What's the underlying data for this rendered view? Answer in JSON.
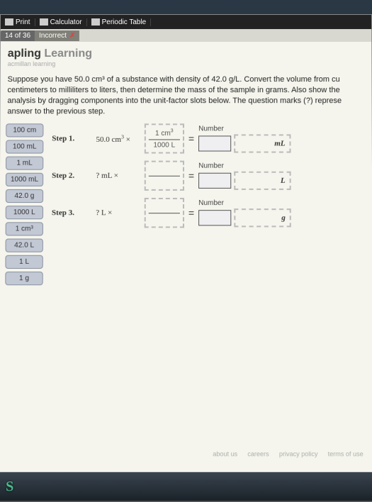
{
  "toolbar": {
    "print": "Print",
    "calculator": "Calculator",
    "periodic": "Periodic Table"
  },
  "tab": {
    "count": "14 of 36",
    "status": "Incorrect"
  },
  "brand": {
    "dark": "apling",
    "light": "Learning",
    "sub": "acmillan learning"
  },
  "question": "Suppose you have 50.0 cm³ of a substance with density of 42.0 g/L. Convert the volume from cu centimeters to milliliters to liters, then determine the mass of the sample in grams. Also show the analysis by dragging components into the unit-factor slots below. The question marks (?) represe answer to the previous step.",
  "palette": [
    "100 cm",
    "100 mL",
    "1 mL",
    "1000 mL",
    "42.0 g",
    "1000 L",
    "1 cm³",
    "42.0 L",
    "1 L",
    "1 g"
  ],
  "steps": {
    "s1": {
      "label": "Step 1.",
      "value_html": "50.0 cm³ ×",
      "frac_top": "1 cm³",
      "frac_bot": "1000 L",
      "answer_label": "Number",
      "unit": "mL"
    },
    "s2": {
      "label": "Step 2.",
      "value_html": "? mL ×",
      "frac_top": "",
      "frac_bot": "",
      "answer_label": "Number",
      "unit": "L"
    },
    "s3": {
      "label": "Step 3.",
      "value_html": "? L ×",
      "frac_top": "",
      "frac_bot": "",
      "answer_label": "Number",
      "unit": "g"
    }
  },
  "footer": {
    "about": "about us",
    "careers": "careers",
    "privacy": "privacy policy",
    "terms": "terms of use"
  },
  "eq": "="
}
